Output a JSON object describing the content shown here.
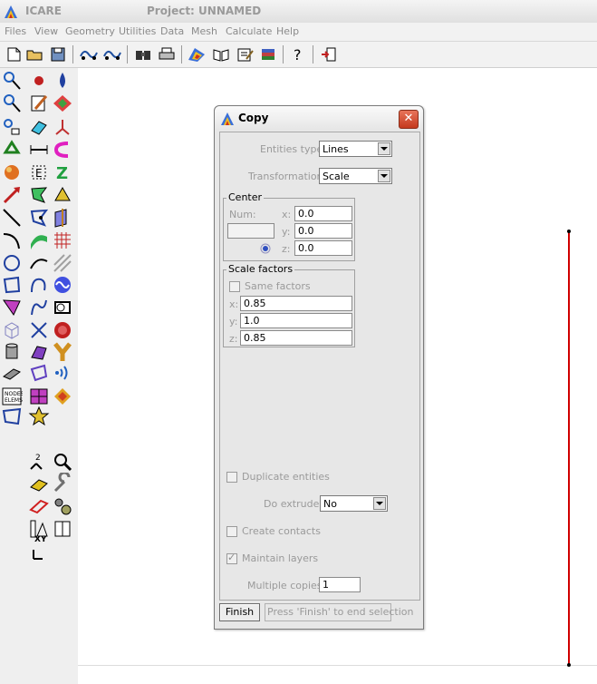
{
  "app": {
    "title": "ICARE",
    "project": "Project: UNNAMED"
  },
  "menu": [
    "Files",
    "View",
    "Geometry",
    "Utilities",
    "Data",
    "Mesh",
    "Calculate",
    "Help"
  ],
  "toolbar": {
    "icons": [
      "new-icon",
      "open-icon",
      "save-icon",
      "wave-icon",
      "wave-alt-icon",
      "binoculars-icon",
      "print-icon",
      "rainbow-icon",
      "book-icon",
      "notes-icon",
      "layers-icon",
      "help-icon",
      "exit-icon"
    ]
  },
  "palette": {
    "icons": [
      "pick-icon",
      "point-icon",
      "water-drop-icon",
      "pick-multi-icon",
      "edit-icon",
      "color-surface-icon",
      "node-icon",
      "eraser-icon",
      "axis-icon",
      "recycle-icon",
      "distance-icon",
      "magnet-icon",
      "sphere-icon",
      "label-e-icon",
      "z-axis-icon",
      "arrow-icon",
      "polygon-icon",
      "solid-icon",
      "line-icon",
      "mesh-node-icon",
      "plane-icon",
      "arc-icon",
      "surface-icon",
      "grid-icon",
      "circle-icon",
      "spline-icon",
      "hatch-icon",
      "quad-icon",
      "connect-icon",
      "sine-icon",
      "polyline-icon",
      "curve-icon",
      "box-shape-icon",
      "cube-icon",
      "cross-icon",
      "target-icon",
      "cylinder-icon",
      "sweep-icon",
      "y-shape-icon",
      "extrude-icon",
      "deform-icon",
      "signal-icon",
      "nodes-elems-icon",
      "mesh-surface-icon",
      "mesh-color-icon",
      "refine-icon",
      "star-icon",
      "",
      "",
      "split-icon",
      "magnify-icon",
      "",
      "flag-icon",
      "wrench-icon",
      "",
      "frame-icon",
      "gears-icon",
      "",
      "measure-icon",
      "manual-icon",
      "",
      "xy-axis-icon",
      ""
    ],
    "xy_label": "XY"
  },
  "dialog": {
    "title": "Copy",
    "close_label": "✕",
    "entities_type_label": "Entities type:",
    "entities_type_value": "Lines",
    "transformation_label": "Transformation:",
    "transformation_value": "Scale",
    "center": {
      "title": "Center",
      "num_label": "Num:",
      "num_value": "",
      "x_label": "x:",
      "x_value": "0.0",
      "y_label": "y:",
      "y_value": "0.0",
      "z_label": "z:",
      "z_value": "0.0"
    },
    "scale": {
      "title": "Scale factors",
      "same_factors_label": "Same factors",
      "same_factors_checked": false,
      "x_label": "x:",
      "x_value": "0.85",
      "y_label": "y:",
      "y_value": "1.0",
      "z_label": "z:",
      "z_value": "0.85"
    },
    "duplicate_label": "Duplicate entities",
    "duplicate_checked": false,
    "do_extrude_label": "Do extrude:",
    "do_extrude_value": "No",
    "create_contacts_label": "Create contacts",
    "create_contacts_checked": false,
    "maintain_layers_label": "Maintain layers",
    "maintain_layers_checked": true,
    "multiple_copies_label": "Multiple copies:",
    "multiple_copies_value": "1",
    "finish_label": "Finish",
    "status_text": "Press 'Finish' to end selection"
  },
  "colors": {
    "line": "#d00000",
    "accent_close": "#c4391d"
  }
}
